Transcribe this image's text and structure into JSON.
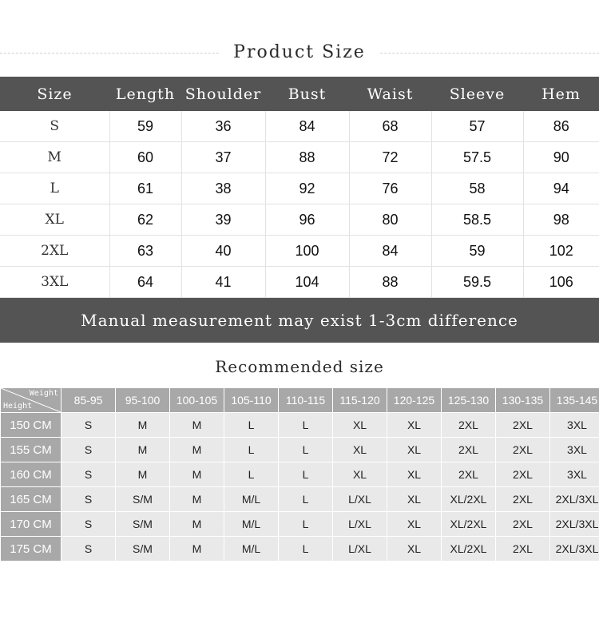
{
  "product_size": {
    "title": "Product Size",
    "columns": [
      "Size",
      "Length",
      "Shoulder",
      "Bust",
      "Waist",
      "Sleeve",
      "Hem"
    ],
    "rows": [
      {
        "size": "S",
        "length": "59",
        "shoulder": "36",
        "bust": "84",
        "waist": "68",
        "sleeve": "57",
        "hem": "86"
      },
      {
        "size": "M",
        "length": "60",
        "shoulder": "37",
        "bust": "88",
        "waist": "72",
        "sleeve": "57.5",
        "hem": "90"
      },
      {
        "size": "L",
        "length": "61",
        "shoulder": "38",
        "bust": "92",
        "waist": "76",
        "sleeve": "58",
        "hem": "94"
      },
      {
        "size": "XL",
        "length": "62",
        "shoulder": "39",
        "bust": "96",
        "waist": "80",
        "sleeve": "58.5",
        "hem": "98"
      },
      {
        "size": "2XL",
        "length": "63",
        "shoulder": "40",
        "bust": "100",
        "waist": "84",
        "sleeve": "59",
        "hem": "102"
      },
      {
        "size": "3XL",
        "length": "64",
        "shoulder": "41",
        "bust": "104",
        "waist": "88",
        "sleeve": "59.5",
        "hem": "106"
      }
    ]
  },
  "notice": {
    "text": "Manual measurement may exist 1-3cm difference"
  },
  "recommended": {
    "title": "Recommended size",
    "corner": {
      "weight_label": "Weight",
      "height_label": "Height"
    },
    "weight_ranges": [
      "85-95",
      "95-100",
      "100-105",
      "105-110",
      "110-115",
      "115-120",
      "120-125",
      "125-130",
      "130-135",
      "135-145"
    ],
    "rows": [
      {
        "height": "150 CM",
        "sizes": [
          "S",
          "M",
          "M",
          "L",
          "L",
          "XL",
          "XL",
          "2XL",
          "2XL",
          "3XL"
        ]
      },
      {
        "height": "155 CM",
        "sizes": [
          "S",
          "M",
          "M",
          "L",
          "L",
          "XL",
          "XL",
          "2XL",
          "2XL",
          "3XL"
        ]
      },
      {
        "height": "160 CM",
        "sizes": [
          "S",
          "M",
          "M",
          "L",
          "L",
          "XL",
          "XL",
          "2XL",
          "2XL",
          "3XL"
        ]
      },
      {
        "height": "165 CM",
        "sizes": [
          "S",
          "S/M",
          "M",
          "M/L",
          "L",
          "L/XL",
          "XL",
          "XL/2XL",
          "2XL",
          "2XL/3XL"
        ]
      },
      {
        "height": "170 CM",
        "sizes": [
          "S",
          "S/M",
          "M",
          "M/L",
          "L",
          "L/XL",
          "XL",
          "XL/2XL",
          "2XL",
          "2XL/3XL"
        ]
      },
      {
        "height": "175 CM",
        "sizes": [
          "S",
          "S/M",
          "M",
          "M/L",
          "L",
          "L/XL",
          "XL",
          "XL/2XL",
          "2XL",
          "2XL/3XL"
        ]
      }
    ]
  },
  "colors": {
    "dark_header": "#545454",
    "gray_header": "#a8a8a8",
    "cell_bg": "#e9e9e9",
    "grid_line": "#e2e2e2"
  }
}
